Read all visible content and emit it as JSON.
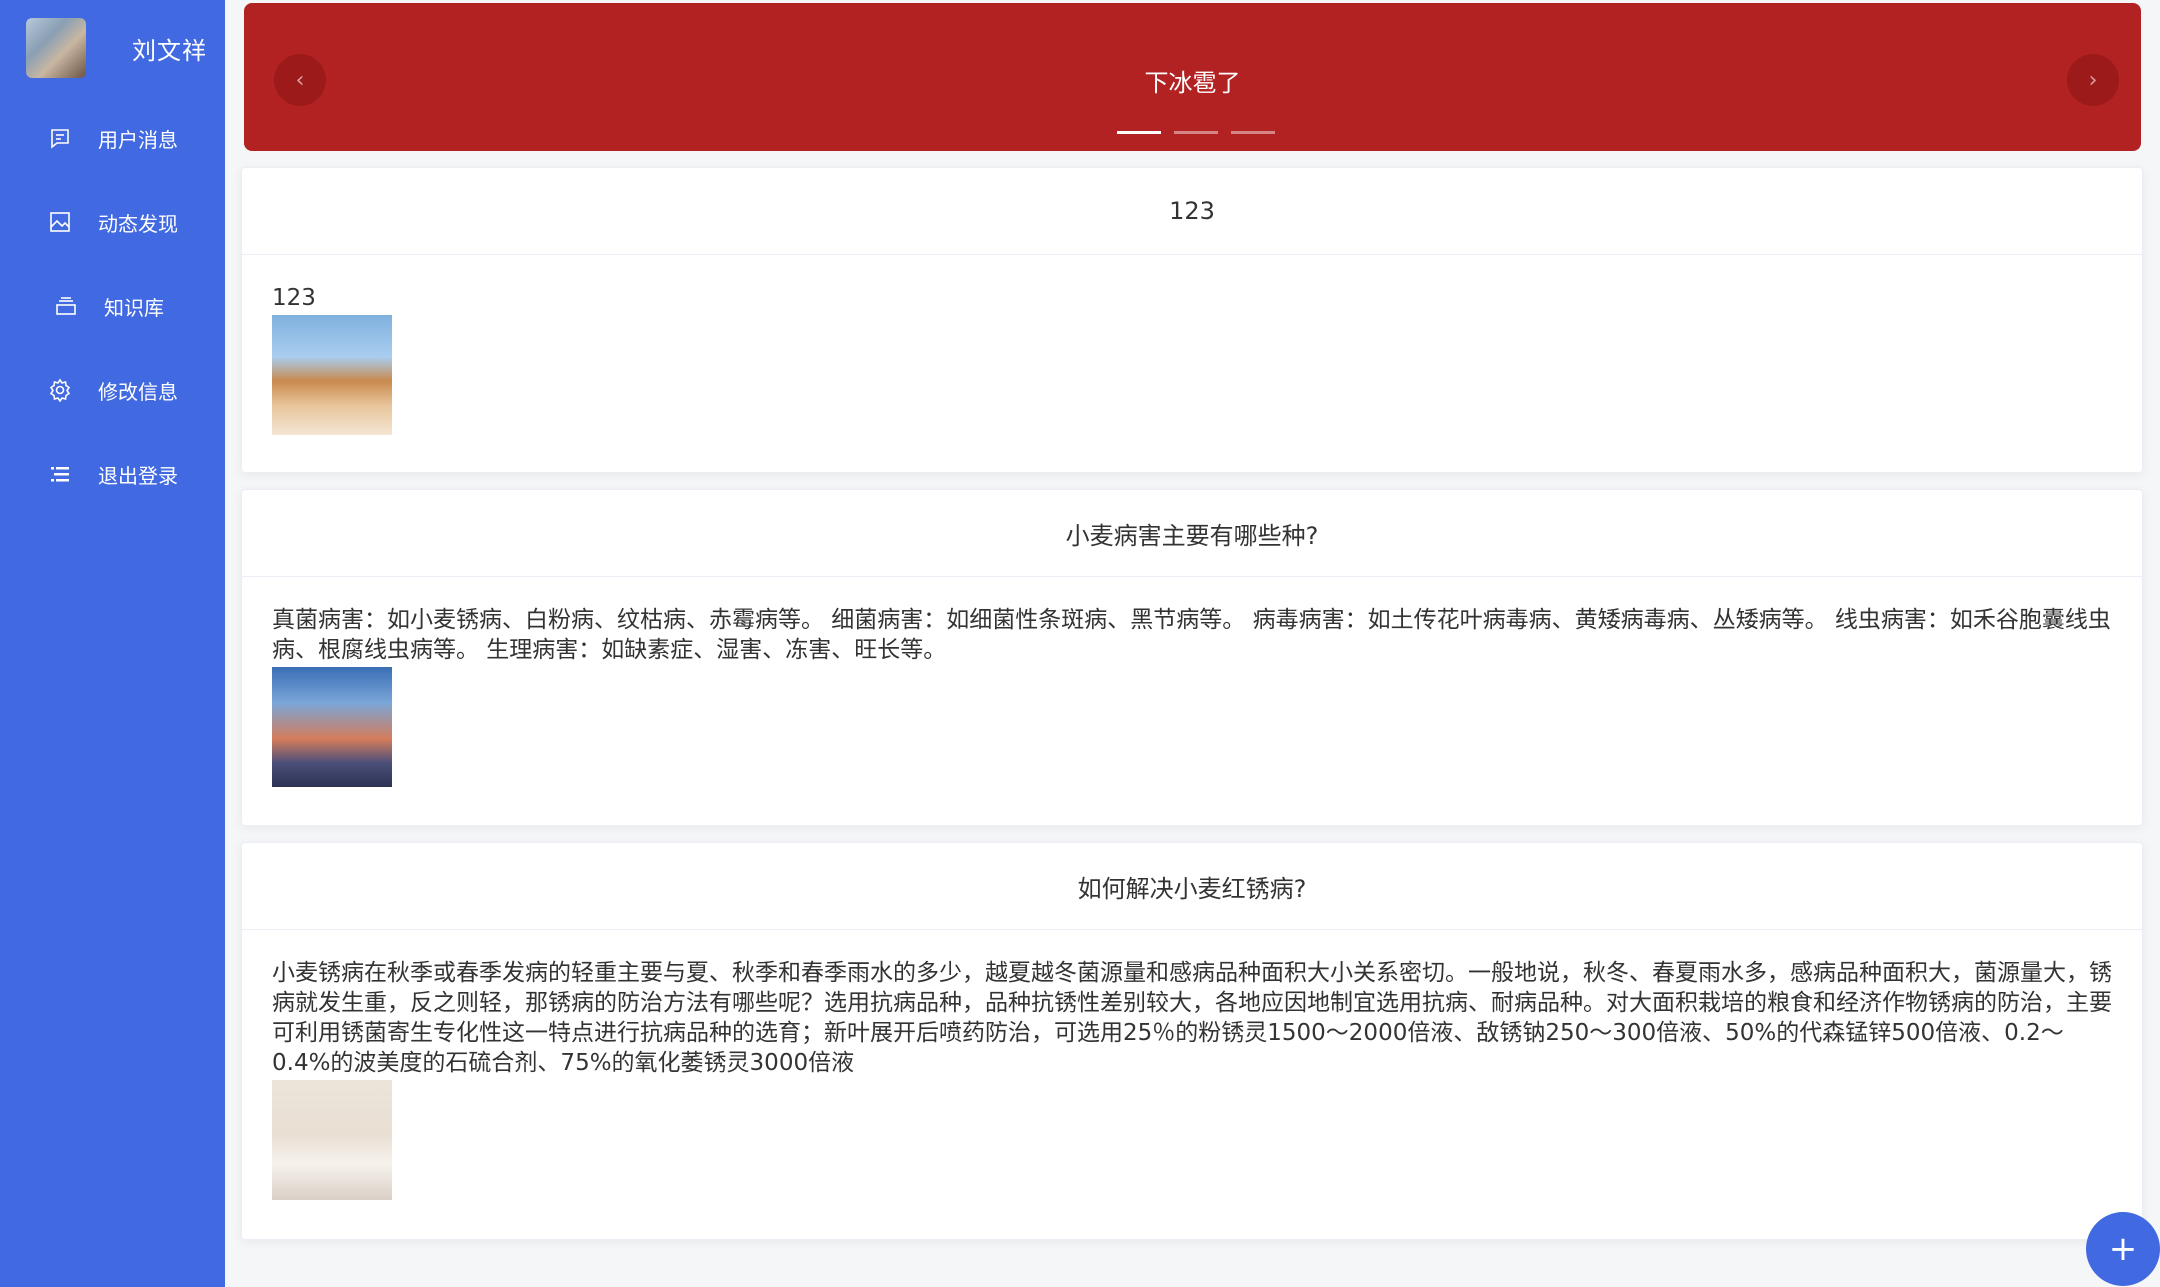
{
  "sidebar": {
    "username": "刘文祥",
    "items": [
      {
        "label": "用户消息",
        "icon": "message-icon"
      },
      {
        "label": "动态发现",
        "icon": "picture-icon"
      },
      {
        "label": "知识库",
        "icon": "stack-icon"
      },
      {
        "label": "修改信息",
        "icon": "gear-icon"
      },
      {
        "label": "退出登录",
        "icon": "list-icon"
      }
    ]
  },
  "carousel": {
    "title": "下冰雹了",
    "prev": "‹",
    "next": "›"
  },
  "posts": [
    {
      "title": "123",
      "content": "123"
    },
    {
      "title": "小麦病害主要有哪些种?",
      "content": "真菌病害：如小麦锈病、白粉病、纹枯病、赤霉病等。 细菌病害：如细菌性条斑病、黑节病等。 病毒病害：如土传花叶病毒病、黄矮病毒病、丛矮病等。 线虫病害：如禾谷胞囊线虫病、根腐线虫病等。 生理病害：如缺素症、湿害、冻害、旺长等。"
    },
    {
      "title": "如何解决小麦红锈病?",
      "content": "小麦锈病在秋季或春季发病的轻重主要与夏、秋季和春季雨水的多少，越夏越冬菌源量和感病品种面积大小关系密切。一般地说，秋冬、春夏雨水多，感病品种面积大，菌源量大，锈病就发生重，反之则轻，那锈病的防治方法有哪些呢？选用抗病品种，品种抗锈性差别较大，各地应因地制宜选用抗病、耐病品种。对大面积栽培的粮食和经济作物锈病的防治，主要可利用锈菌寄生专化性这一特点进行抗病品种的选育；新叶展开后喷药防治，可选用25％的粉锈灵1500～2000倍液、敌锈钠250～300倍液、50%的代森锰锌500倍液、0.2～0.4%的波美度的石硫合剂、75%的氧化萎锈灵3000倍液"
    }
  ],
  "fab": {
    "label": "+"
  }
}
